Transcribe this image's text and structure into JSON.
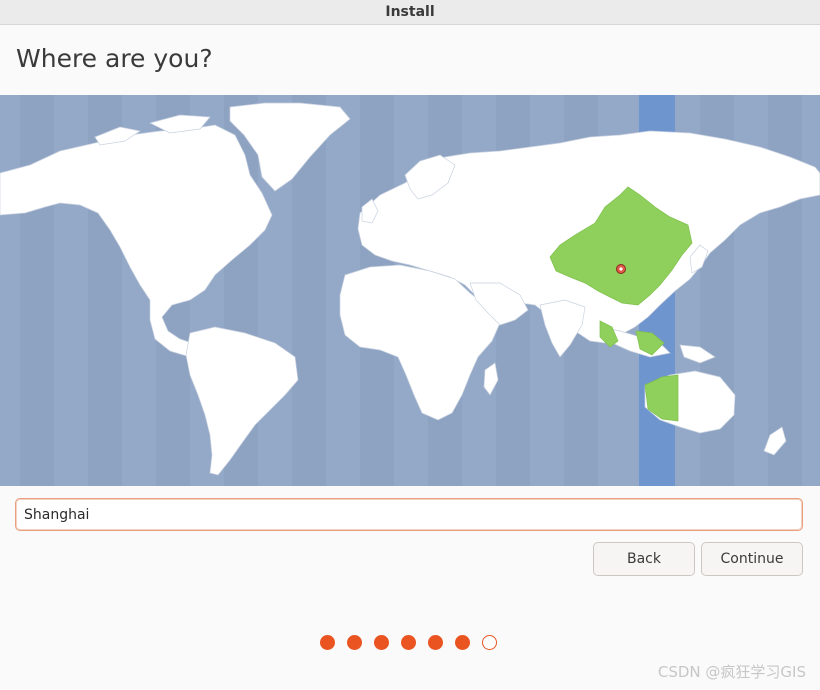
{
  "window": {
    "title": "Install"
  },
  "page": {
    "heading": "Where are you?"
  },
  "location": {
    "value": "Shanghai",
    "placeholder": ""
  },
  "buttons": {
    "back_label": "Back",
    "continue_label": "Continue"
  },
  "progress": {
    "total_steps": 7,
    "completed_steps": 6
  },
  "map": {
    "selected_timezone": "Shanghai",
    "highlight_color": "#8fcf5b",
    "ocean_color": "#94a9c8",
    "land_color": "#ffffff",
    "band_color": "#6f95cf",
    "marker_color": "#e05a4a"
  },
  "watermark": {
    "text": "CSDN @疯狂学习GIS"
  },
  "colors": {
    "accent": "#e95420",
    "field_border": "#e9a07f"
  }
}
